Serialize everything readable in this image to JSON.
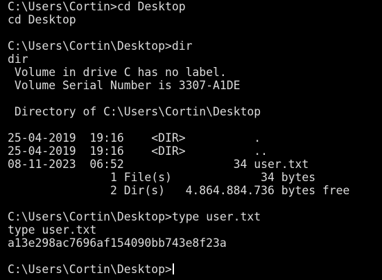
{
  "terminal": {
    "lines": [
      "C:\\Users\\Cortin>cd Desktop",
      "cd Desktop",
      "",
      "C:\\Users\\Cortin\\Desktop>dir",
      "dir",
      " Volume in drive C has no label.",
      " Volume Serial Number is 3307-A1DE",
      "",
      " Directory of C:\\Users\\Cortin\\Desktop",
      "",
      "25-04-2019  19:16    <DIR>          .",
      "25-04-2019  19:16    <DIR>          ..",
      "08-11-2023  06:52                34 user.txt",
      "               1 File(s)             34 bytes",
      "               2 Dir(s)   4.864.884.736 bytes free",
      "",
      "C:\\Users\\Cortin\\Desktop>type user.txt",
      "type user.txt",
      "a13e298ac7696af154090bb743e8f23a",
      ""
    ],
    "prompt": "C:\\Users\\Cortin\\Desktop>",
    "colors": {
      "background": "#000000",
      "foreground": "#dcdcdc",
      "cursor": "#ffffff"
    }
  }
}
